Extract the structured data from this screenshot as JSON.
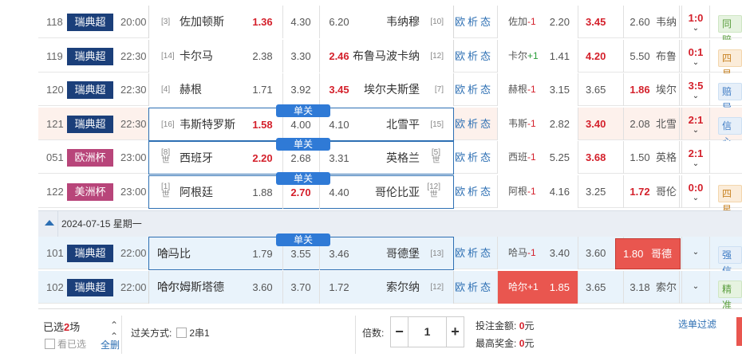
{
  "matches_top": [
    {
      "num": "118",
      "league": "瑞典超",
      "league_color": "#1b3f7a",
      "time": "20:00",
      "home_rank": "[3]",
      "home": "佐加顿斯",
      "o1": "1.36",
      "o1r": true,
      "o2": "4.30",
      "o2r": false,
      "o3": "6.20",
      "o3r": false,
      "away": "韦纳穆",
      "away_rank": "[10]",
      "h_team": "佐加",
      "h_sign": "-1",
      "h_sign_type": "m",
      "h_val": "2.20",
      "d_val": "3.45",
      "d_red": true,
      "a_val": "2.60",
      "a_team": "韦纳",
      "score": "1:0",
      "tag": "同赔",
      "tag_type": "green",
      "hl": false,
      "sel": false,
      "dan": false
    },
    {
      "num": "119",
      "league": "瑞典超",
      "league_color": "#1b3f7a",
      "time": "22:30",
      "home_rank": "[14]",
      "home": "卡尔马",
      "o1": "2.38",
      "o1r": false,
      "o2": "3.30",
      "o2r": false,
      "o3": "2.46",
      "o3r": true,
      "away": "布鲁马波卡纳",
      "away_rank": "[12]",
      "h_team": "卡尔",
      "h_sign": "+1",
      "h_sign_type": "p",
      "h_val": "1.41",
      "d_val": "4.20",
      "d_red": true,
      "a_val": "5.50",
      "a_team": "布鲁",
      "score": "0:1",
      "tag": "四星",
      "tag_type": "orange",
      "hl": false,
      "sel": false,
      "dan": false
    },
    {
      "num": "120",
      "league": "瑞典超",
      "league_color": "#1b3f7a",
      "time": "22:30",
      "home_rank": "[4]",
      "home": "赫根",
      "o1": "1.71",
      "o1r": false,
      "o2": "3.92",
      "o2r": false,
      "o3": "3.45",
      "o3r": true,
      "away": "埃尔夫斯堡",
      "away_rank": "[7]",
      "h_team": "赫根",
      "h_sign": "-1",
      "h_sign_type": "m",
      "h_val": "3.15",
      "d_val": "3.65",
      "d_red": false,
      "a_val": "1.86",
      "a_red": true,
      "a_team": "埃尔",
      "score": "3:5",
      "tag": "赔异",
      "tag_type": "blue",
      "hl": false,
      "sel": false,
      "dan": false
    },
    {
      "num": "121",
      "league": "瑞典超",
      "league_color": "#1b3f7a",
      "time": "22:30",
      "home_rank": "[16]",
      "home": "韦斯特罗斯",
      "o1": "1.58",
      "o1r": true,
      "o2": "4.00",
      "o2r": false,
      "o3": "4.10",
      "o3r": false,
      "away": "北雪平",
      "away_rank": "[15]",
      "h_team": "韦斯",
      "h_sign": "-1",
      "h_sign_type": "m",
      "h_val": "2.82",
      "d_val": "3.40",
      "d_red": true,
      "a_val": "2.08",
      "a_team": "北雪",
      "score": "2:1",
      "tag": "信心",
      "tag_type": "blue",
      "hl": true,
      "sel": true,
      "dan": true
    },
    {
      "num": "051",
      "league": "欧洲杯",
      "league_color": "#b8457a",
      "time": "23:00",
      "home_rank": "[8]",
      "home_sub": "世",
      "home": "西班牙",
      "o1": "2.20",
      "o1r": true,
      "o2": "2.68",
      "o2r": false,
      "o3": "3.31",
      "o3r": false,
      "away": "英格兰",
      "away_rank": "[5]",
      "away_sub": "世",
      "h_team": "西班",
      "h_sign": "-1",
      "h_sign_type": "m",
      "h_val": "5.25",
      "d_val": "3.68",
      "d_red": true,
      "a_val": "1.50",
      "a_team": "英格",
      "score": "2:1",
      "tag": "",
      "tag_type": "",
      "hl": false,
      "sel": true,
      "dan": true
    },
    {
      "num": "122",
      "league": "美洲杯",
      "league_color": "#b8457a",
      "time": "23:00",
      "home_rank": "[1]",
      "home_sub": "世",
      "home": "阿根廷",
      "o1": "1.88",
      "o1r": false,
      "o2": "2.70",
      "o2r": true,
      "o3": "4.40",
      "o3r": false,
      "away": "哥伦比亚",
      "away_rank": "[12]",
      "away_sub": "世",
      "h_team": "阿根",
      "h_sign": "-1",
      "h_sign_type": "m",
      "h_val": "4.16",
      "d_val": "3.25",
      "d_red": false,
      "a_val": "1.72",
      "a_red": true,
      "a_team": "哥伦",
      "score": "0:0",
      "tag": "四星",
      "tag_type": "orange",
      "hl": false,
      "sel": true,
      "dan": true
    }
  ],
  "date_label": "2024-07-15 星期一",
  "matches_bottom": [
    {
      "num": "101",
      "league": "瑞典超",
      "league_color": "#1b3f7a",
      "time": "22:00",
      "home_rank": "[6]",
      "home": "哈马比",
      "o1": "1.79",
      "o2": "3.55",
      "o3": "3.46",
      "away": "哥德堡",
      "away_rank": "[13]",
      "h_team": "哈马",
      "h_sign": "-1",
      "h_val": "3.40",
      "d_val": "3.60",
      "a_val": "1.80",
      "a_team": "哥德",
      "tag": "强信",
      "tag_type": "blue",
      "dan": true,
      "sel": true
    },
    {
      "num": "102",
      "league": "瑞典超",
      "league_color": "#1b3f7a",
      "time": "22:00",
      "home_rank": "[10]",
      "home": "哈尔姆斯塔德",
      "o1": "3.60",
      "o2": "3.70",
      "o3": "1.72",
      "away": "索尔纳",
      "away_rank": "[12]",
      "h_team": "哈尔",
      "h_sign": "+1",
      "h_val": "1.85",
      "d_val": "3.65",
      "a_val": "3.18",
      "a_team": "索尔",
      "tag": "精准",
      "tag_type": "green",
      "dan": false,
      "sel": false
    }
  ],
  "labels": {
    "analysis": "欧析态",
    "dan": "单关",
    "selected_prefix": "已选",
    "selected_count": "2",
    "selected_suffix": "场",
    "view_selected": "看已选",
    "delete_all": "全删",
    "pass_mode": "过关方式:",
    "pass_option": "2串1",
    "multiplier": "倍数:",
    "multiplier_value": "1",
    "stake_label": "投注金额:",
    "stake_value": "0",
    "stake_unit": "元",
    "max_prize_label": "最高奖金:",
    "max_prize_value": "0",
    "prize_unit": "元",
    "filter": "选单过滤"
  }
}
